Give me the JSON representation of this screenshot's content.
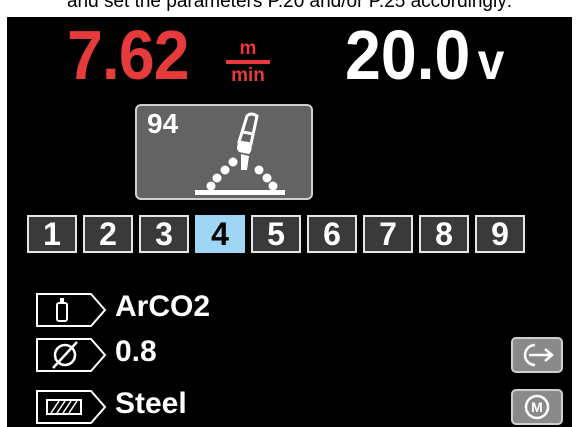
{
  "caption": "and set the parameters P.20 and/or P.25 accordingly:",
  "wire_speed": {
    "value": "7.62",
    "unit_top": "m",
    "unit_bottom": "min"
  },
  "voltage": {
    "value": "20.0",
    "unit": "v"
  },
  "program": {
    "number": "94",
    "icon": "mig-torch-spray-icon"
  },
  "memory_slots": {
    "active": "4",
    "labels": [
      "1",
      "2",
      "3",
      "4",
      "5",
      "6",
      "7",
      "8",
      "9"
    ]
  },
  "parameters": {
    "gas": {
      "icon": "gas-cylinder-icon",
      "value": "ArCO2"
    },
    "wire_diameter": {
      "icon": "diameter-icon",
      "value": "0.8"
    },
    "material": {
      "icon": "material-plate-icon",
      "value": "Steel"
    }
  },
  "side_buttons": {
    "exit": {
      "icon": "exit-arrow-icon"
    },
    "memory": {
      "icon": "memory-m-icon",
      "label": "M"
    }
  },
  "colors": {
    "screen_bg": "#000000",
    "wire_speed": "#e53b3b",
    "active_slot": "#9fd6f5",
    "program_box": "#636363"
  }
}
